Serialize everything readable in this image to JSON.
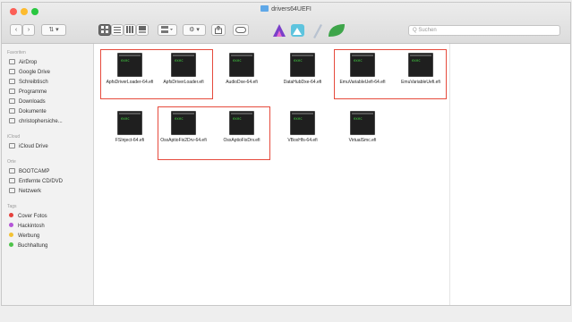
{
  "window": {
    "title": "drivers64UEFI"
  },
  "toolbar": {
    "back": "‹",
    "forward": "›",
    "path_menu": "⇅ ▾",
    "action_menu": "⚙ ▾",
    "search_placeholder": "Q Suchen"
  },
  "sidebar": {
    "sections": [
      {
        "title": "Favoriten",
        "items": [
          {
            "label": "AirDrop",
            "icon": "airdrop-icon"
          },
          {
            "label": "Google Drive",
            "icon": "folder-icon"
          },
          {
            "label": "Schreibtisch",
            "icon": "desktop-icon"
          },
          {
            "label": "Programme",
            "icon": "apps-icon"
          },
          {
            "label": "Downloads",
            "icon": "downloads-icon"
          },
          {
            "label": "Dokumente",
            "icon": "documents-icon"
          },
          {
            "label": "christophersiche...",
            "icon": "home-icon"
          }
        ]
      },
      {
        "title": "iCloud",
        "items": [
          {
            "label": "iCloud Drive",
            "icon": "cloud-icon"
          }
        ]
      },
      {
        "title": "Orte",
        "items": [
          {
            "label": "BOOTCAMP",
            "icon": "disk-icon"
          },
          {
            "label": "Entfernte CD/DVD",
            "icon": "cd-icon"
          },
          {
            "label": "Netzwerk",
            "icon": "network-icon"
          }
        ]
      },
      {
        "title": "Tags",
        "items": [
          {
            "label": "Cover Fotos",
            "color": "#e5413c"
          },
          {
            "label": "Hackintosh",
            "color": "#b455d8"
          },
          {
            "label": "Werbung",
            "color": "#f3c233"
          },
          {
            "label": "Buchhaltung",
            "color": "#4ec34a"
          }
        ]
      }
    ]
  },
  "files": [
    "ApfsDriverLoader-64.efi",
    "ApfsDriverLoader.efi",
    "AudioDxe-64.efi",
    "DataHubDxe-64.efi",
    "EmuVariableUefi-64.efi",
    "EmuVariableUefi.efi",
    "FSInject-64.efi",
    "OsxAptioFix2Drv-64.efi",
    "OsxAptioFixDrv.efi",
    "VBoxHfs-64.efi",
    "VirtualSmc.efi"
  ],
  "exec_prompt": "exec",
  "colors": {
    "highlight": "#e64a3c",
    "folder": "#5fa8e8"
  }
}
